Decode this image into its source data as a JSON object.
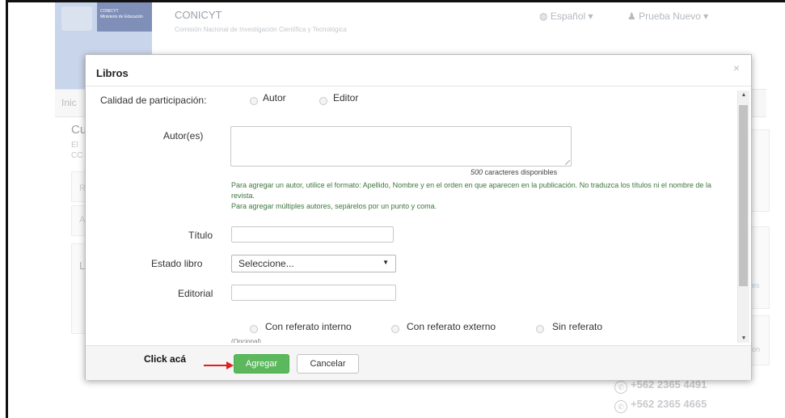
{
  "header": {
    "brand_name": "CONICYT",
    "brand_sub": "Ministerio de Educación",
    "title": "CONICYT",
    "subtitle": "Comisión Nacional de Investigación Científica y Tecnológica",
    "language": "Español",
    "user": "Prueba Nuevo"
  },
  "background": {
    "nav_first": "Inic",
    "heading": "Cu",
    "text_line1": "El",
    "text_line2": "CC",
    "box1_letter": "R",
    "box2_letter": "A",
    "box3_letter": "L",
    "right_link_fragment": "es",
    "right_text_fragment": "on",
    "phones": [
      "+562 2365 4491",
      "+562 2365 4665"
    ]
  },
  "modal": {
    "title": "Libros",
    "close_symbol": "×",
    "participation": {
      "label": "Calidad de participación:",
      "options": [
        "Autor",
        "Editor"
      ]
    },
    "authors": {
      "label": "Autor(es)",
      "value": "",
      "chars_count": "500",
      "chars_text": "caracteres disponibles",
      "help_line1": "Para agregar un autor, utilice el formato: Apellido, Nombre y en el orden en que aparecen en la publicación. No traduzca los títulos ni el nombre de la revista.",
      "help_line2": "Para agregar múltiples autores, sepárelos por un punto y coma."
    },
    "title_field": {
      "label": "Título",
      "value": ""
    },
    "book_status": {
      "label": "Estado libro",
      "selected": "Seleccione..."
    },
    "publisher": {
      "label": "Editorial",
      "value": ""
    },
    "referee": {
      "options": [
        "Con referato interno",
        "Con referato externo",
        "Sin referato"
      ]
    },
    "optional_text": "(Opcional)",
    "footer": {
      "annotation": "Click acá",
      "add_label": "Agregar",
      "cancel_label": "Cancelar"
    }
  },
  "colors": {
    "success_green": "#5cb85c",
    "help_green": "#3c763d",
    "annotation_arrow": "#e02020"
  }
}
